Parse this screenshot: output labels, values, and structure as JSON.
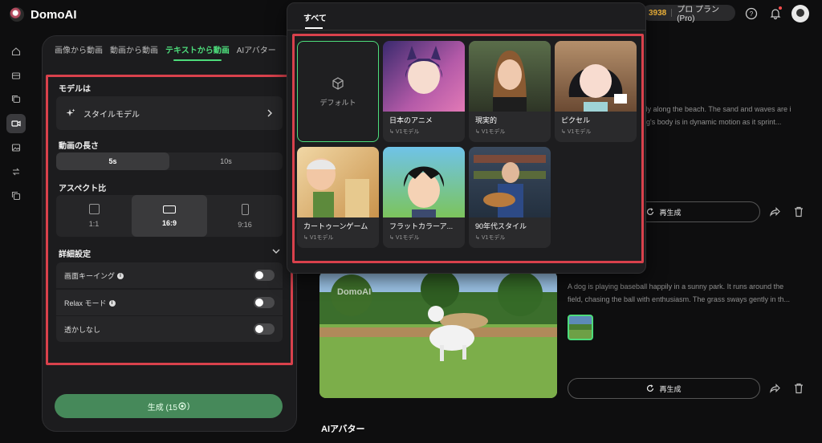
{
  "app": {
    "name": "DomoAI"
  },
  "header": {
    "credits": "3938",
    "plan": "プロ プラン(Pro)"
  },
  "left_tabs": [
    "画像から動画",
    "動画から動画",
    "テキストから動画",
    "AIアバター"
  ],
  "settings": {
    "model_label": "モデルは",
    "model_value": "スタイルモデル",
    "length_label": "動画の長さ",
    "length_options": [
      "5s",
      "10s"
    ],
    "aspect_label": "アスペクト比",
    "aspect_options": [
      "1:1",
      "16:9",
      "9:16"
    ],
    "advanced_label": "詳細設定",
    "toggles": [
      "画面キーイング",
      "Relax モード",
      "透かしなし"
    ],
    "generate_label": "生成 (15",
    "generate_suffix": ")"
  },
  "popup": {
    "tab": "すべて",
    "default_label": "デフォルト",
    "cards": [
      {
        "title": "日本のアニメ",
        "sub": "V1モデル"
      },
      {
        "title": "現実的",
        "sub": "V1モデル"
      },
      {
        "title": "ピクセル",
        "sub": "V1モデル"
      },
      {
        "title": "カートゥーンゲーム",
        "sub": "V1モデル"
      },
      {
        "title": "フラットカラーア...",
        "sub": "V1モデル"
      },
      {
        "title": "90年代スタイル",
        "sub": "V1モデル"
      }
    ]
  },
  "results": {
    "desc1_a": "fully along the beach. The sand and waves are i",
    "desc1_b": "dog's body is in dynamic motion as it sprint...",
    "desc2_a": "A dog is playing baseball happily in a sunny park. It runs around the",
    "desc2_b": "field, chasing the ball with enthusiasm. The grass sways gently in th...",
    "regen_label": "再生成",
    "watermark": "DomoAI",
    "section_title": "AIアバター"
  },
  "colors": {
    "accent": "#4ddc7b",
    "highlight": "#d9414c",
    "generate": "#46895a"
  },
  "icons": [
    "logo-icon",
    "help-icon",
    "bell-icon",
    "home-icon",
    "box-icon",
    "gallery-icon",
    "video-icon",
    "image-icon",
    "swap-icon",
    "copy-icon",
    "sparkle-icon",
    "chevron-right-icon",
    "chevron-down-icon",
    "cube-icon",
    "share-icon",
    "trash-icon",
    "refresh-icon"
  ]
}
